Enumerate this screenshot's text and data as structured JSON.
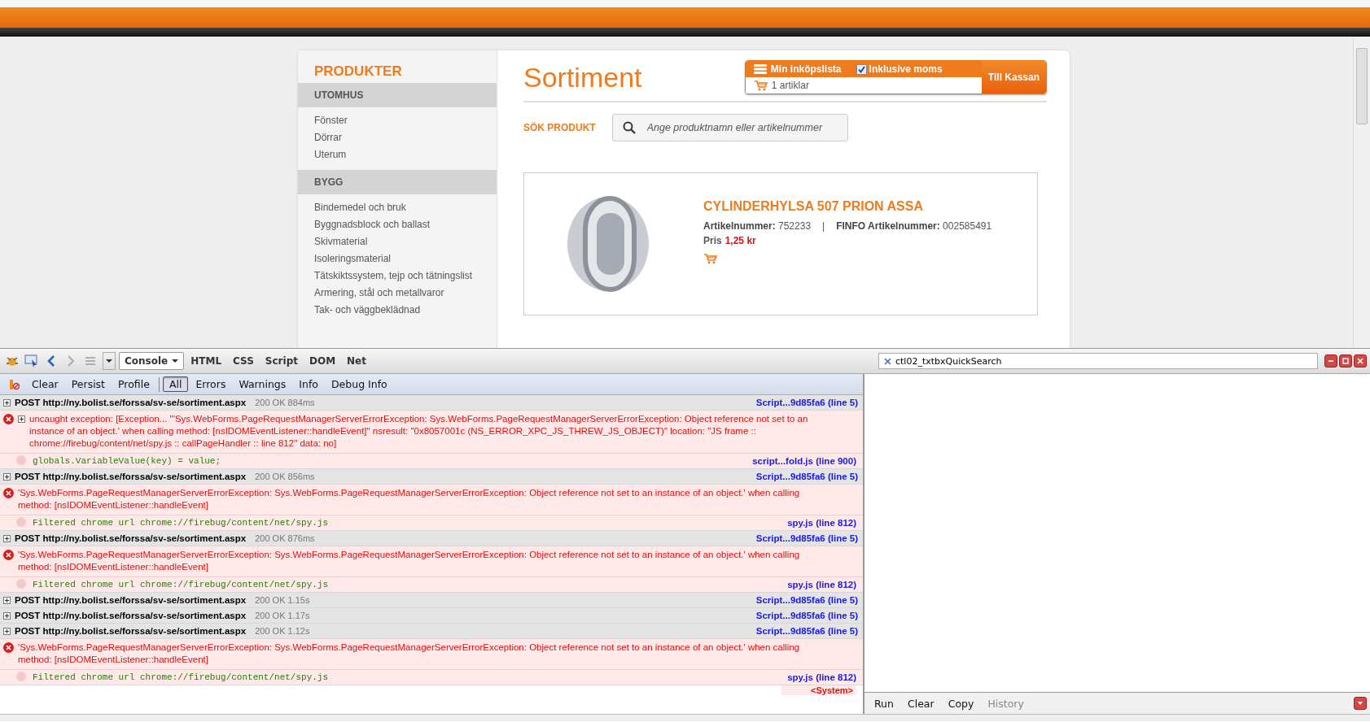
{
  "shop": {
    "sidebar": {
      "title": "PRODUKTER",
      "sections": [
        {
          "heading": "UTOMHUS",
          "items": [
            "Fönster",
            "Dörrar",
            "Uterum"
          ]
        },
        {
          "heading": "BYGG",
          "items": [
            "Bindemedel och bruk",
            "Byggnadsblock och ballast",
            "Skivmaterial",
            "Isoleringsmaterial",
            "Tätskiktssystem, tejp och tätningslist",
            "Armering, stål och metallvaror",
            "Tak- och väggbeklädnad"
          ]
        }
      ]
    },
    "title": "Sortiment",
    "cart": {
      "list_label": "Min inköpslista",
      "vat_label": "Inklusive moms",
      "vat_checked": true,
      "count": "1 artiklar",
      "checkout": "Till Kassan"
    },
    "search": {
      "label": "SÖK PRODUKT",
      "placeholder": "Ange produktnamn eller artikelnummer"
    },
    "product": {
      "name": "CYLINDERHYLSA 507 PRION ASSA",
      "article": "**Artikelnummer:** 752233",
      "separator": "|",
      "finfo": "**FINFO Artikelnummer:** 002585491",
      "price_label": "Pris",
      "price": "1,25 kr"
    }
  },
  "devtools": {
    "tabs": [
      {
        "label": "Console",
        "selected": true
      },
      {
        "label": "HTML",
        "selected": false
      },
      {
        "label": "CSS",
        "selected": false
      },
      {
        "label": "Script",
        "selected": false
      },
      {
        "label": "DOM",
        "selected": false
      },
      {
        "label": "Net",
        "selected": false
      }
    ],
    "search_value": "ctl02_txtbxQuickSearch",
    "console_actions": [
      "Clear",
      "Persist",
      "Profile"
    ],
    "filters": [
      {
        "label": "All",
        "selected": true
      },
      {
        "label": "Errors",
        "selected": false
      },
      {
        "label": "Warnings",
        "selected": false
      },
      {
        "label": "Info",
        "selected": false
      },
      {
        "label": "Debug Info",
        "selected": false
      }
    ],
    "entries": [
      {
        "kind": "post",
        "text": "POST http://ny.bolist.se/forssa/sv-se/sortiment.aspx",
        "status": "200 OK 884ms",
        "source": "Script...9d85fa6 (line 5)"
      },
      {
        "kind": "error",
        "expandable": true,
        "text": "uncaught exception: [Exception... \"'Sys.WebForms.PageRequestManagerServerErrorException: Sys.WebForms.PageRequestManagerServerErrorException: Object reference not set to an instance of an object.' when calling method: [nsIDOMEventListener::handleEvent]\"  nsresult: \"0x8057001c (NS_ERROR_XPC_JS_THREW_JS_OBJECT)\"  location: \"JS frame :: chrome://firebug/content/net/spy.js :: callPageHandler :: line 812\"  data: no]"
      },
      {
        "kind": "trace",
        "text": "globals.VariableValue(key) = value;",
        "source": "script...fold.js (line 900)"
      },
      {
        "kind": "post",
        "text": "POST http://ny.bolist.se/forssa/sv-se/sortiment.aspx",
        "status": "200 OK 856ms",
        "source": "Script...9d85fa6 (line 5)"
      },
      {
        "kind": "error",
        "expandable": false,
        "text": "'Sys.WebForms.PageRequestManagerServerErrorException: Sys.WebForms.PageRequestManagerServerErrorException: Object reference not set to an instance of an object.' when calling method: [nsIDOMEventListener::handleEvent]"
      },
      {
        "kind": "trace",
        "text": "Filtered chrome url chrome://firebug/content/net/spy.js",
        "source": "spy.js (line 812)"
      },
      {
        "kind": "post",
        "text": "POST http://ny.bolist.se/forssa/sv-se/sortiment.aspx",
        "status": "200 OK 876ms",
        "source": "Script...9d85fa6 (line 5)"
      },
      {
        "kind": "error",
        "expandable": false,
        "text": "'Sys.WebForms.PageRequestManagerServerErrorException: Sys.WebForms.PageRequestManagerServerErrorException: Object reference not set to an instance of an object.' when calling method: [nsIDOMEventListener::handleEvent]"
      },
      {
        "kind": "trace",
        "text": "Filtered chrome url chrome://firebug/content/net/spy.js",
        "source": "spy.js (line 812)"
      },
      {
        "kind": "post",
        "text": "POST http://ny.bolist.se/forssa/sv-se/sortiment.aspx",
        "status": "200 OK 1.15s",
        "source": "Script...9d85fa6 (line 5)"
      },
      {
        "kind": "post",
        "text": "POST http://ny.bolist.se/forssa/sv-se/sortiment.aspx",
        "status": "200 OK 1.17s",
        "source": "Script...9d85fa6 (line 5)"
      },
      {
        "kind": "post",
        "text": "POST http://ny.bolist.se/forssa/sv-se/sortiment.aspx",
        "status": "200 OK 1.12s",
        "source": "Script...9d85fa6 (line 5)"
      },
      {
        "kind": "error",
        "expandable": false,
        "text": "'Sys.WebForms.PageRequestManagerServerErrorException: Sys.WebForms.PageRequestManagerServerErrorException: Object reference not set to an instance of an object.' when calling method: [nsIDOMEventListener::handleEvent]"
      },
      {
        "kind": "trace",
        "text": "Filtered chrome url chrome://firebug/content/net/spy.js",
        "source": "spy.js (line 812)"
      }
    ],
    "system_label": "<System>",
    "command_actions": [
      {
        "label": "Run",
        "disabled": false
      },
      {
        "label": "Clear",
        "disabled": false
      },
      {
        "label": "Copy",
        "disabled": false
      },
      {
        "label": "History",
        "disabled": true
      }
    ]
  }
}
